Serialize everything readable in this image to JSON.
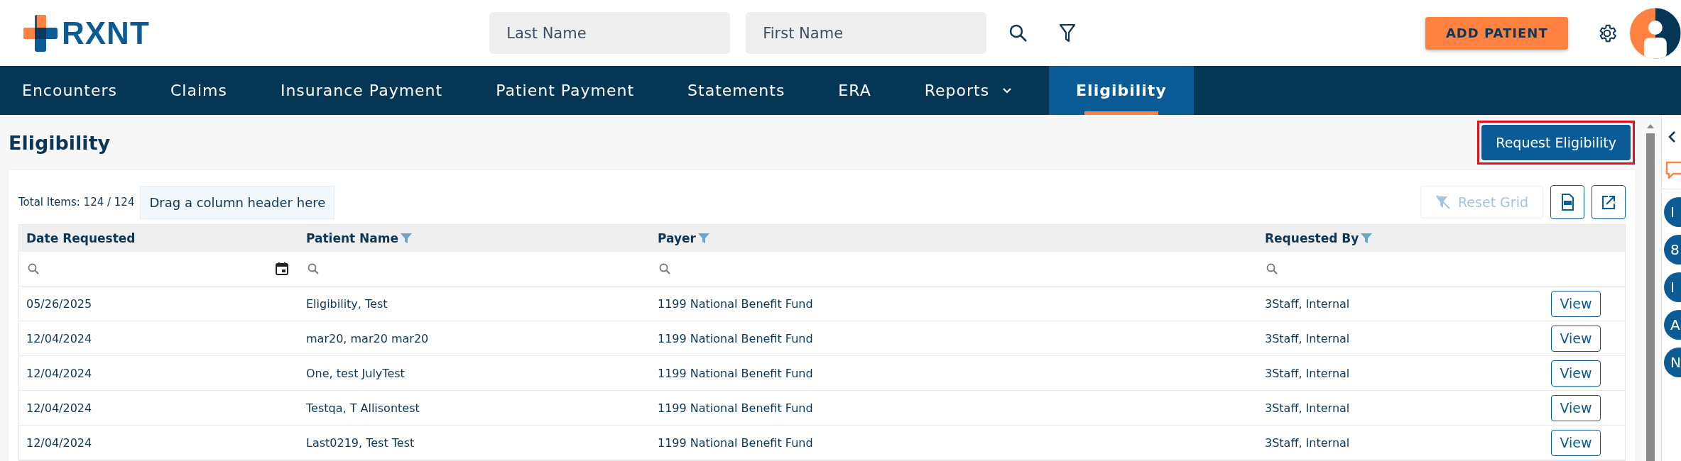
{
  "header": {
    "logo": "RXNT",
    "search_fields": [
      {
        "placeholder": "Last Name"
      },
      {
        "placeholder": "First Name"
      }
    ],
    "add_button": "ADD PATIENT"
  },
  "nav": [
    {
      "label": "Encounters",
      "selected": false,
      "dropdown": false
    },
    {
      "label": "Claims",
      "selected": false,
      "dropdown": false
    },
    {
      "label": "Insurance Payment",
      "selected": false,
      "dropdown": false
    },
    {
      "label": "Patient Payment",
      "selected": false,
      "dropdown": false
    },
    {
      "label": "Statements",
      "selected": false,
      "dropdown": false
    },
    {
      "label": "ERA",
      "selected": false,
      "dropdown": false
    },
    {
      "label": "Reports",
      "selected": false,
      "dropdown": true
    },
    {
      "label": "Eligibility",
      "selected": true,
      "dropdown": false
    }
  ],
  "page": {
    "title": "Eligibility",
    "action_button": {
      "label": "Request Eligibility",
      "highlighted": true
    }
  },
  "grid": {
    "total_items": "Total Items: 124 / 124",
    "group_hint": "Drag a column header here",
    "reset_button": {
      "label": "Reset Grid",
      "disabled": true
    },
    "columns": [
      {
        "label": "Date Requested",
        "filterable": false,
        "kind": "date"
      },
      {
        "label": "Patient Name",
        "filterable": true,
        "kind": "text"
      },
      {
        "label": "Payer",
        "filterable": true,
        "kind": "text"
      },
      {
        "label": "Requested By",
        "filterable": true,
        "kind": "text"
      }
    ],
    "rows": [
      {
        "cells": [
          "05/26/2025",
          "Eligibility, Test",
          "1199 National Benefit Fund",
          "3Staff, Internal"
        ],
        "action": "View"
      },
      {
        "cells": [
          "12/04/2024",
          "mar20, mar20 mar20",
          "1199 National Benefit Fund",
          "3Staff, Internal"
        ],
        "action": "View"
      },
      {
        "cells": [
          "12/04/2024",
          "One, test JulyTest",
          "1199 National Benefit Fund",
          "3Staff, Internal"
        ],
        "action": "View"
      },
      {
        "cells": [
          "12/04/2024",
          "Testqa, T Allisontest",
          "1199 National Benefit Fund",
          "3Staff, Internal"
        ],
        "action": "View"
      },
      {
        "cells": [
          "12/04/2024",
          "Last0219, Test Test",
          "1199 National Benefit Fund",
          "3Staff, Internal"
        ],
        "action": "View"
      }
    ]
  },
  "rail": {
    "badges": [
      "I",
      "8",
      "I",
      "A",
      "N"
    ]
  }
}
